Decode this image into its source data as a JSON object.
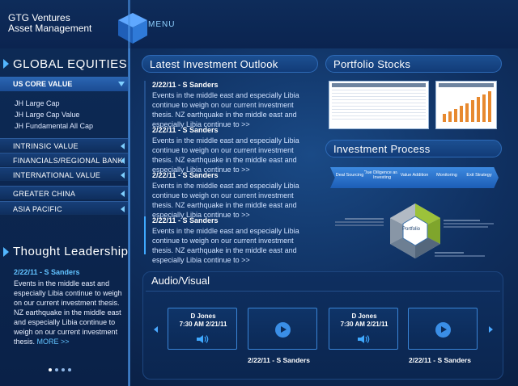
{
  "header": {
    "brand_line1": "GTG Ventures",
    "brand_line2": "Asset Management",
    "menu_label": "MENU"
  },
  "sidebar": {
    "global_equities_title": "GLOBAL EQUITIES",
    "us_core_value": "US CORE VALUE",
    "us_core_items": [
      "JH Large Cap",
      "JH Large Cap Value",
      "JH Fundamental All Cap"
    ],
    "categories": [
      "INTRINSIC VALUE",
      "FINANCIALS/REGIONAL BANK",
      "INTERNATIONAL VALUE",
      "GREATER CHINA",
      "ASIA PACIFIC"
    ],
    "thought_leadership": {
      "title": "Thought Leadership",
      "date": "2/22/11 - S Sanders",
      "text": "Events in the middle east and especially Libia continue to weigh on our current investment thesis. NZ earthquake in the middle east and especially Libia continue to weigh on our current investment thesis.",
      "more": "MORE >>"
    },
    "pager": {
      "count": 4,
      "active": 0
    }
  },
  "outlook": {
    "title": "Latest Investment Outlook",
    "items": [
      {
        "date": "2/22/11 - S Sanders",
        "text": "Events in the middle east and especially Libia continue to weigh on our current investment thesis. NZ earthquake  in the middle east and especially Libia continue to >>"
      },
      {
        "date": "2/22/11 - S Sanders",
        "text": "Events in the middle east and especially Libia continue to weigh on our current investment thesis. NZ earthquake in the middle east and especially Libia continue to >>"
      },
      {
        "date": "2/22/11 - S Sanders",
        "text": "Events in the middle east and especially Libia continue to weigh on our current investment thesis. NZ earthquake in the middle east and especially Libia continue to >>"
      },
      {
        "date": "2/22/11 - S Sanders",
        "text": "Events in the middle east and especially Libia continue to weigh on our current investment thesis. NZ earthquake in the middle east and especially Libia continue to >>"
      }
    ]
  },
  "portfolio": {
    "title": "Portfolio Stocks"
  },
  "process": {
    "title": "Investment Process",
    "steps": [
      "Deal Sourcing",
      "Due Diligence and Investing",
      "Value Addition",
      "Monitoring",
      "Exit Strategy"
    ],
    "hex_label": "Portfolio"
  },
  "audio_visual": {
    "title": "Audio/Visual",
    "tiles": [
      {
        "kind": "audio",
        "name": "D Jones",
        "when": "7:30 AM 2/21/11"
      },
      {
        "kind": "video"
      },
      {
        "kind": "audio",
        "name": "D Jones",
        "when": "7:30 AM 2/21/11"
      },
      {
        "kind": "video"
      }
    ],
    "captions": [
      "2/22/11 - S Sanders",
      "2/22/11 - S Sanders"
    ]
  },
  "colors": {
    "accent": "#3fa9ff",
    "background": "#0f2f5f",
    "highlight": "#62c3ff"
  }
}
